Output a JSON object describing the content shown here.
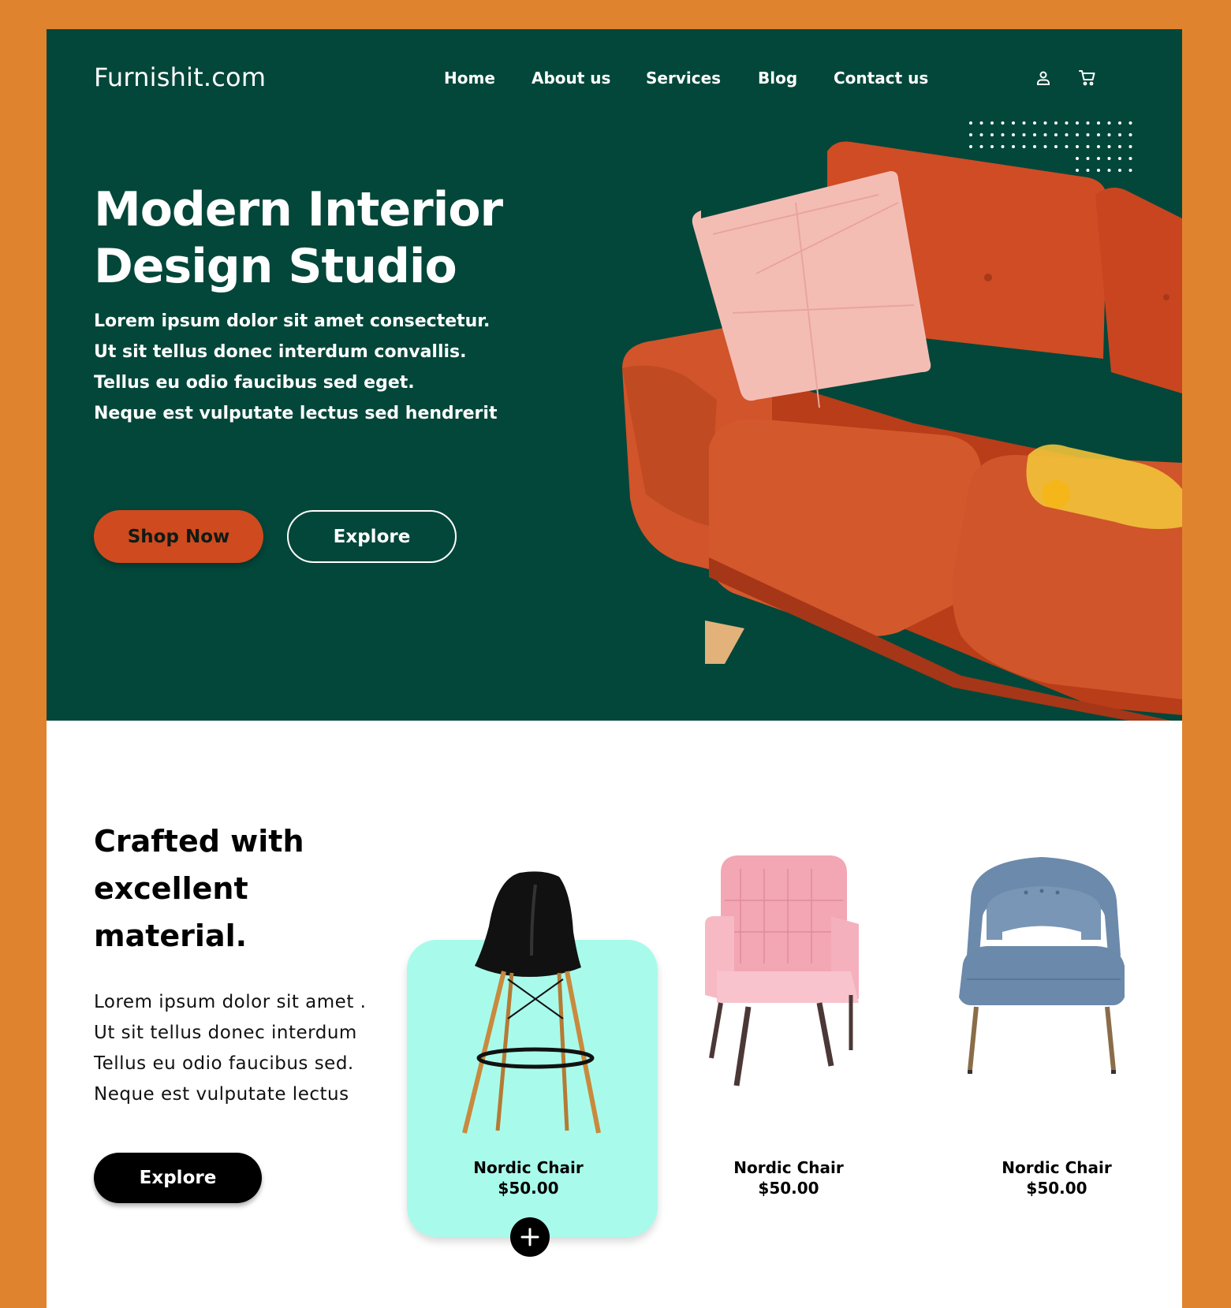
{
  "header": {
    "logo": "Furnishit.com",
    "nav": [
      {
        "label": "Home"
      },
      {
        "label": "About us"
      },
      {
        "label": "Services"
      },
      {
        "label": "Blog"
      },
      {
        "label": "Contact us"
      }
    ],
    "icons": [
      "user-icon",
      "cart-icon"
    ]
  },
  "hero": {
    "title_line1": "Modern Interior",
    "title_line2": "Design Studio",
    "text": [
      "Lorem ipsum dolor sit amet consectetur.",
      "Ut sit tellus donec interdum convallis.",
      "Tellus eu odio faucibus sed eget.",
      "Neque est vulputate lectus sed hendrerit"
    ],
    "shop_button": "Shop Now",
    "explore_button": "Explore"
  },
  "products_section": {
    "title": "Crafted with excellent material.",
    "text": [
      "Lorem ipsum dolor sit amet .",
      "Ut sit tellus donec interdum",
      "Tellus eu odio faucibus sed.",
      "Neque est vulputate lectus"
    ],
    "explore_button": "Explore",
    "products": [
      {
        "name": "Nordic Chair",
        "price": "$50.00",
        "image": "black-bar-stool",
        "highlighted": true
      },
      {
        "name": "Nordic Chair",
        "price": "$50.00",
        "image": "pink-armchair",
        "highlighted": false
      },
      {
        "name": "Nordic Chair",
        "price": "$50.00",
        "image": "blue-armchair",
        "highlighted": false
      }
    ]
  },
  "colors": {
    "page_bg": "#e0832f",
    "hero_bg": "#03473a",
    "accent": "#cf4a1e",
    "card_highlight": "#a8fbeb"
  }
}
